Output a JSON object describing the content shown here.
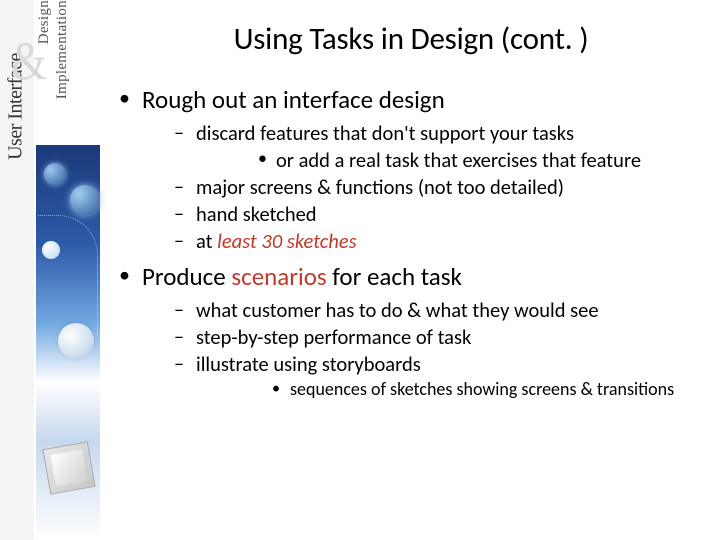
{
  "sidebar": {
    "title": "User Interface",
    "subtitle1": "Design",
    "subtitle2": "Implementation",
    "amp": "&"
  },
  "slide": {
    "title": "Using Tasks in Design (cont. )",
    "bullets": [
      {
        "text": "Rough out an interface design",
        "sub": [
          {
            "text": "discard features that don't support your tasks",
            "sub": [
              {
                "text": "or add a real task that exercises that feature"
              }
            ]
          },
          {
            "text": "major screens & functions (not too detailed)"
          },
          {
            "text": "hand sketched"
          },
          {
            "prefix": "at ",
            "em": "least 30 sketches",
            "em_style": "hl it"
          }
        ]
      },
      {
        "prefix": "Produce ",
        "em": "scenarios",
        "suffix": " for each task",
        "em_style": "hl",
        "sub": [
          {
            "text": "what customer has to do & what they would see"
          },
          {
            "text": "step-by-step performance of task"
          },
          {
            "text": "illustrate using storyboards",
            "sub_small": [
              {
                "text": "sequences of sketches showing screens & transitions"
              }
            ]
          }
        ]
      }
    ]
  }
}
